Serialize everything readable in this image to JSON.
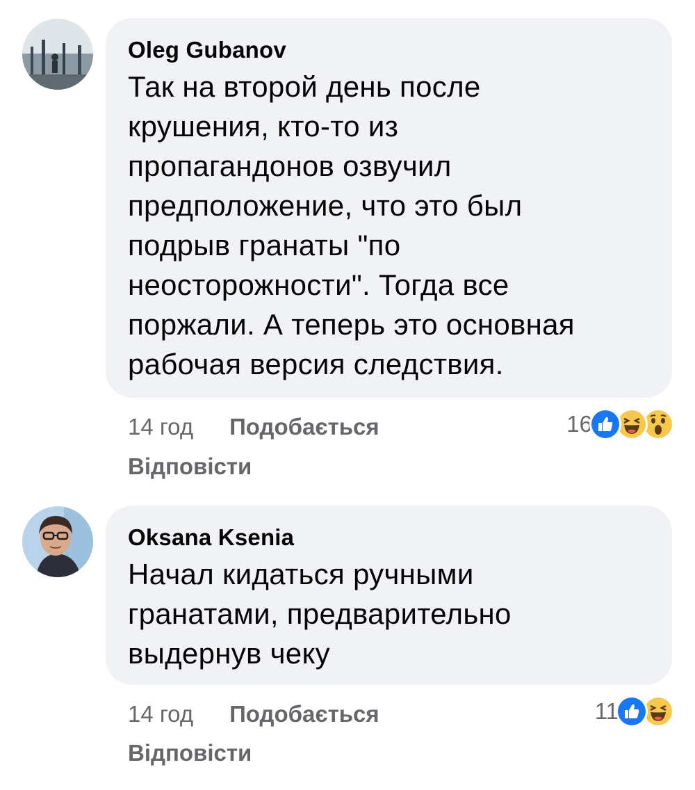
{
  "comments": [
    {
      "author": "Oleg Gubanov",
      "text": "Так на второй день после\nкрушения, кто-то из\nпропагандонов озвучил\nпредположение, что это был\nподрыв гранаты \"по\nнеосторожности\". Тогда все\nпоржали. А теперь это основная\nрабочая версия следствия.",
      "time": "14 год",
      "like_label": "Подобається",
      "reply_label": "Відповісти",
      "reaction_count": "16",
      "reactions": [
        "like-icon",
        "haha-icon",
        "wow-icon"
      ]
    },
    {
      "author": "Oksana Ksenia",
      "text": "Начал кидаться ручными\nгранатами, предварительно\nвыдернув чеку",
      "time": "14 год",
      "like_label": "Подобається",
      "reply_label": "Відповісти",
      "reaction_count": "11",
      "reactions": [
        "like-icon",
        "haha-icon"
      ]
    }
  ],
  "colors": {
    "bubble": "#f0f2f5",
    "text": "#050505",
    "meta": "#65676b",
    "like_blue": "#1877f2",
    "emoji_yellow": "#f7c84b"
  }
}
